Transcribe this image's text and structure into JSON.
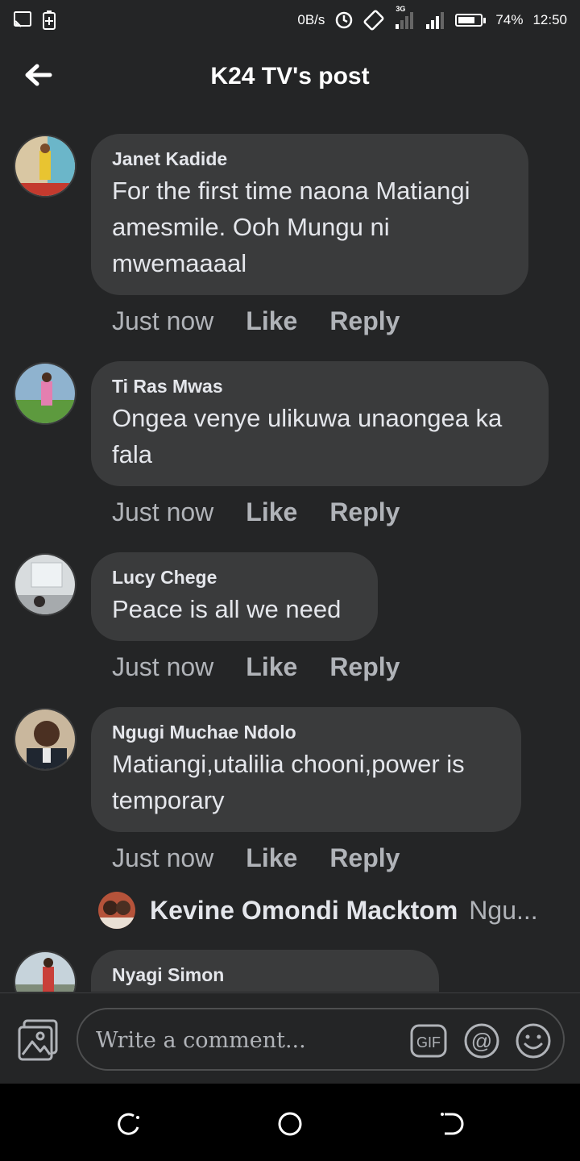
{
  "status_bar": {
    "net_speed": "0B/s",
    "network_type": "3G",
    "battery": "74%",
    "battery_level": 0.74,
    "time": "12:50"
  },
  "header": {
    "title": "K24 TV's post"
  },
  "comments": [
    {
      "author": "Janet Kadide",
      "text": "For the first time naona Matiangi amesmile.  Ooh Mungu ni mwemaaaal",
      "time": "Just now",
      "like": "Like",
      "reply": "Reply"
    },
    {
      "author": "Ti Ras Mwas",
      "text": "Ongea venye ulikuwa unaongea ka fala",
      "time": "Just now",
      "like": "Like",
      "reply": "Reply"
    },
    {
      "author": "Lucy Chege",
      "text": "Peace is all we need",
      "time": "Just now",
      "like": "Like",
      "reply": "Reply"
    },
    {
      "author": "Ngugi Muchae Ndolo",
      "text": "Matiangi,utalilia chooni,power is temporary",
      "time": "Just now",
      "like": "Like",
      "reply": "Reply"
    },
    {
      "author": "Nyagi Simon"
    }
  ],
  "reply_preview": {
    "name": "Kevine Omondi Macktom",
    "preview": "Ngu..."
  },
  "composer": {
    "placeholder": "Write a comment...",
    "gif_label": "GIF",
    "mention_label": "@"
  },
  "icons": {
    "back": "arrow-left-icon",
    "photo": "photo-icon",
    "gif": "gif-icon",
    "mention": "at-icon",
    "emoji": "smiley-icon"
  },
  "colors": {
    "background": "#242526",
    "bubble": "#3a3b3c",
    "primary_text": "#e4e6eb",
    "secondary_text": "#b0b3b8"
  }
}
